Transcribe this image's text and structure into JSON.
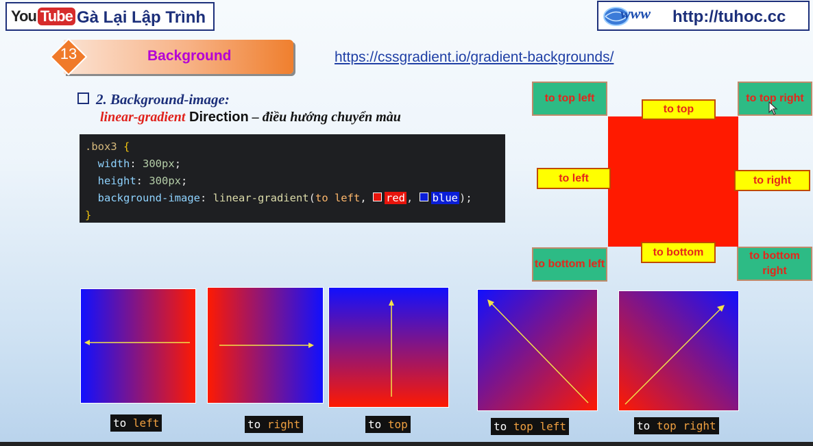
{
  "header": {
    "logo_you": "You",
    "logo_tube": "Tube",
    "channel_title": "Gà Lại Lập Trình",
    "site_logo": "www",
    "site_url": "http://tuhoc.cc"
  },
  "lesson": {
    "number": "13",
    "title": "Background",
    "reference_link": "https://cssgradient.io/gradient-backgrounds/"
  },
  "section": {
    "heading": "2. Background-image:",
    "keyword": "linear-gradient",
    "direction": "Direction",
    "dash": " – ",
    "description": "điều hướng chuyển màu"
  },
  "code": {
    "selector": ".box3",
    "open_brace": "{",
    "close_brace": "}",
    "line1_prop": "width",
    "line1_val": "300px",
    "line2_prop": "height",
    "line2_val": "300px",
    "line3_prop": "background-image",
    "line3_fn": "linear-gradient",
    "line3_dir": "to left",
    "color1": "red",
    "color2": "blue"
  },
  "diagram": {
    "top_left": "to top left",
    "top": "to top",
    "top_right": "to top right",
    "left": "to left",
    "right": "to right",
    "bottom_left": "to bottom left",
    "bottom": "to bottom",
    "bottom_right": "to bottom right"
  },
  "demos": [
    {
      "kw": "to",
      "dir": "left"
    },
    {
      "kw": "to",
      "dir": "right"
    },
    {
      "kw": "to",
      "dir": "top"
    },
    {
      "kw": "to",
      "dir": "top left"
    },
    {
      "kw": "to",
      "dir": "top right"
    }
  ],
  "colors": {
    "red": "#ff1a00",
    "blue": "#1010ff",
    "arrow": "#f2e24a"
  }
}
